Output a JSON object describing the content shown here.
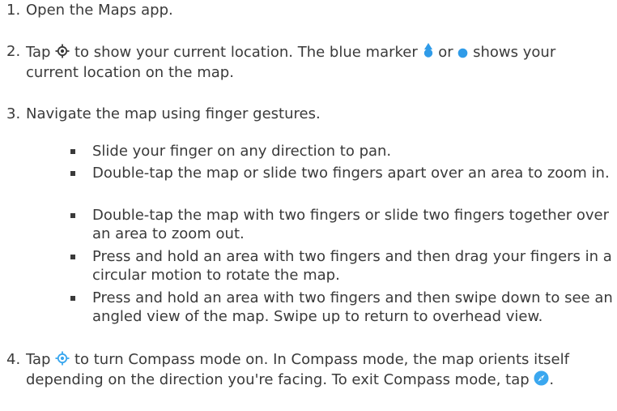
{
  "steps": [
    {
      "number": "1.",
      "text": "Open the Maps app."
    },
    {
      "number": "2.",
      "part1": "Tap",
      "part2": "to show your current location. The blue marker",
      "part3": "or",
      "part4": "shows your current location on the map."
    },
    {
      "number": "3.",
      "text": "Navigate the map using finger gestures."
    },
    {
      "number": "4.",
      "part1": "Tap",
      "part2": "to turn Compass mode on. In Compass mode, the map orients itself depending on the direction you're facing. To exit Compass mode, tap",
      "part3": "."
    }
  ],
  "bullets": [
    "Slide your finger on any direction to pan.",
    "Double-tap the map or slide two fingers apart over an area to zoom in.",
    "Double-tap the map with two fingers or slide two fingers together over an area to zoom out.",
    "Press and hold an area with two fingers and then drag your fingers in a circular motion to rotate the map.",
    "Press and hold an area with two fingers and then swipe down to see an angled view of the map. Swipe up to return to overhead view."
  ],
  "icons": {
    "locate": "locate-icon",
    "marker_arrow": "location-arrow-marker-icon",
    "marker_dot": "location-dot-marker-icon",
    "compass_mode": "compass-mode-icon",
    "compass_exit": "compass-exit-icon"
  },
  "colors": {
    "text": "#3a3a3a",
    "marker_blue": "#2f9be8",
    "compass_blue": "#3aa7ef"
  }
}
